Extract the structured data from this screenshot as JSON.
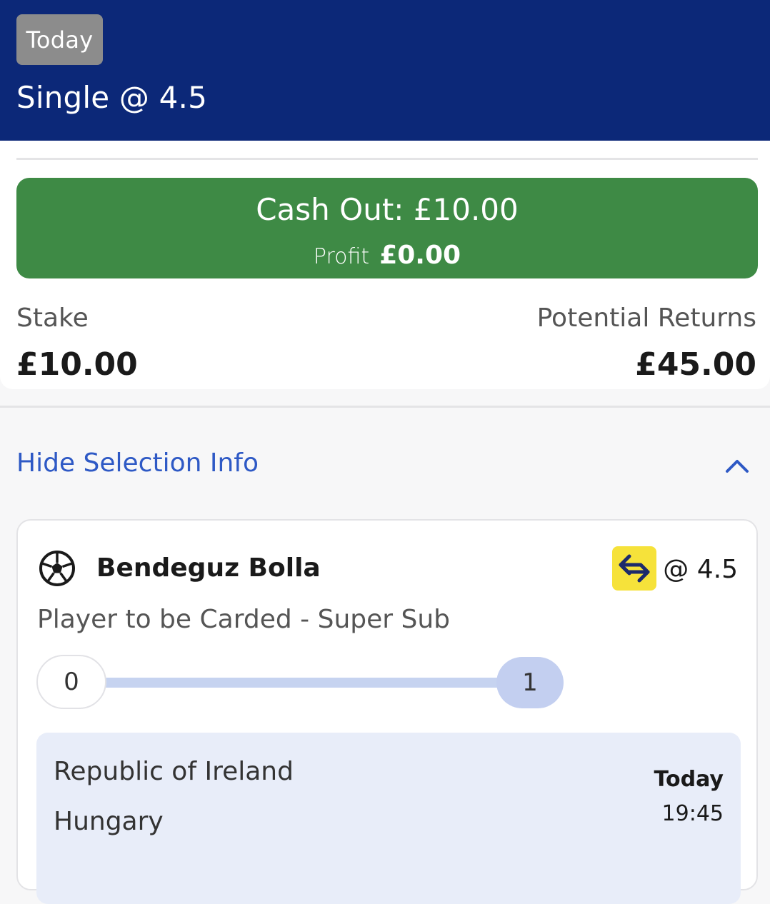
{
  "header": {
    "date_chip": "Today",
    "bet_title": "Single @ 4.5"
  },
  "cashout": {
    "label": "Cash Out: £10.00",
    "profit_label": "Profit",
    "profit_value": "£0.00"
  },
  "summary": {
    "stake_label": "Stake",
    "stake_value": "£10.00",
    "returns_label": "Potential Returns",
    "returns_value": "£45.00"
  },
  "selection_toggle": {
    "label": "Hide Selection Info",
    "icon": "chevron-up-icon"
  },
  "selection": {
    "sport_icon": "football-icon",
    "player": "Bendeguz Bolla",
    "boost_icon": "swap-arrows-icon",
    "odds": "@ 4.5",
    "market": "Player to be Carded - Super Sub",
    "progress": {
      "start": "0",
      "end": "1",
      "fraction": 1.0
    },
    "event": {
      "home": "Republic of Ireland",
      "away": "Hungary",
      "day": "Today",
      "time": "19:45"
    }
  },
  "colors": {
    "header_bg": "#0c2878",
    "cashout_bg": "#3e8a45",
    "link": "#2e59c5",
    "boost_bg": "#f6e23a",
    "progress": "#c6d3f0"
  }
}
